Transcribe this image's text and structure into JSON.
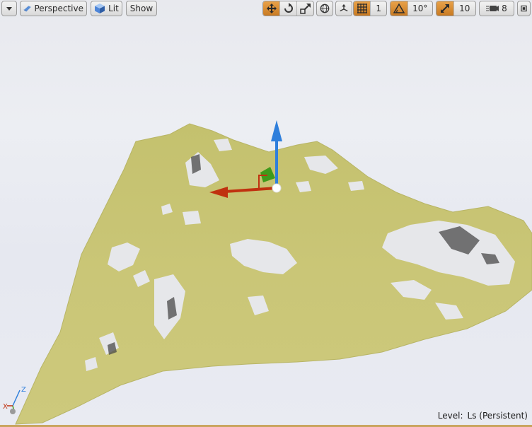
{
  "toolbar": {
    "view_mode_label": "Perspective",
    "lighting_label": "Lit",
    "show_label": "Show",
    "grid_snap_value": "1",
    "rotation_snap_value": "10°",
    "scale_snap_value": "10",
    "camera_speed_value": "8",
    "icons": [
      "dropdown-arrow",
      "perspective-icon",
      "lit-cube-icon",
      "translate-icon",
      "rotate-icon",
      "scale-icon",
      "world-local-icon",
      "surface-snap-icon",
      "grid-snap-icon",
      "rotation-snap-icon",
      "scale-snap-icon",
      "camera-speed-icon",
      "maximize-icon"
    ],
    "accent_color": "#d98b2c"
  },
  "viewport": {
    "terrain_color": "#c9c576",
    "gizmo_colors": {
      "x": "#c0310f",
      "y": "#3f9a1b",
      "z": "#2f7fdc"
    }
  },
  "axis_widget": {
    "x_label": "X",
    "z_label": "Z"
  },
  "status": {
    "level_key": "Level:",
    "level_value": "Ls (Persistent)"
  }
}
